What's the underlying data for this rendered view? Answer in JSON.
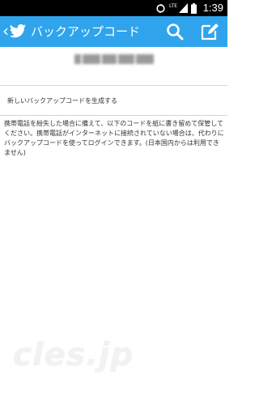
{
  "status_bar": {
    "time": "1:39",
    "network_label": "LTE",
    "icons": [
      "sync-icon",
      "signal-icon",
      "battery-icon"
    ],
    "background_color": "#000000"
  },
  "action_bar": {
    "title": "バックアップコード",
    "background_color": "#2fa4ec",
    "icons": [
      "back-caret-icon",
      "twitter-bird-icon",
      "search-icon",
      "compose-icon"
    ]
  },
  "code": {
    "obscured": true
  },
  "generate": {
    "label": "新しいバックアップコードを生成する"
  },
  "info": {
    "text": "携帯電話を紛失した場合に備えて、以下のコードを紙に書き留めて保管してください。携帯電話がインターネットに接続されていない場合は、代わりにバックアップコードを使ってログインできます。(日本国内からは利用できません)"
  },
  "watermark": {
    "text": "cles.jp"
  }
}
